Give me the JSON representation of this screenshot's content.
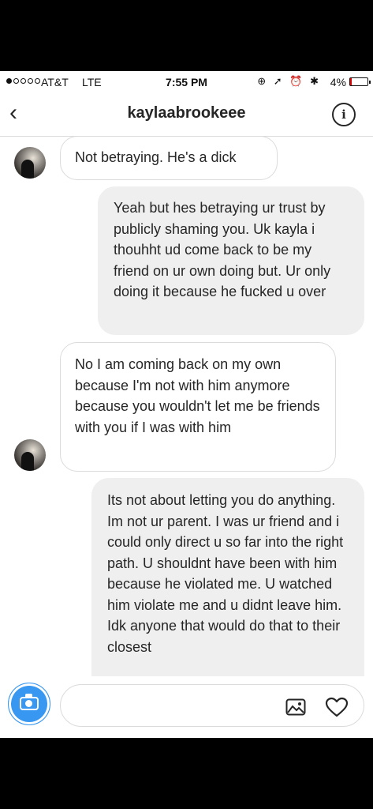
{
  "status_bar": {
    "signal_filled": 1,
    "signal_total": 5,
    "carrier": "AT&T",
    "network": "LTE",
    "time": "7:55 PM",
    "icons": "⊕ ➚ ⏰ ✱",
    "battery_percent": "4%"
  },
  "header": {
    "back_glyph": "‹",
    "username": "kaylaabrookeee",
    "info_glyph": "i"
  },
  "messages": [
    {
      "sender": "them",
      "text": "Not betraying. He's a dick"
    },
    {
      "sender": "me",
      "text": "Yeah but hes betraying ur trust by publicly shaming you. Uk kayla i thouhht ud come back to be my friend on ur own doing but. Ur only doing it because he fucked u over"
    },
    {
      "sender": "them",
      "text": "No I am coming back on my own because I'm not with him anymore because you wouldn't let me be friends with you if I was with him"
    },
    {
      "sender": "me",
      "text": "Its not about letting you do anything. Im not ur parent. I was ur friend and i could only direct u so far into the right path. U shouldnt have been with him because he violated me. U watched him violate me and u didnt leave him. Idk anyone that would do that to their closest"
    }
  ],
  "composer": {
    "camera_icon": "camera-icon",
    "gallery_icon": "gallery-icon",
    "heart_icon": "heart-icon"
  },
  "colors": {
    "accent": "#3897f0",
    "outgoing_bubble": "#efefef",
    "border": "#dbdbdb"
  }
}
